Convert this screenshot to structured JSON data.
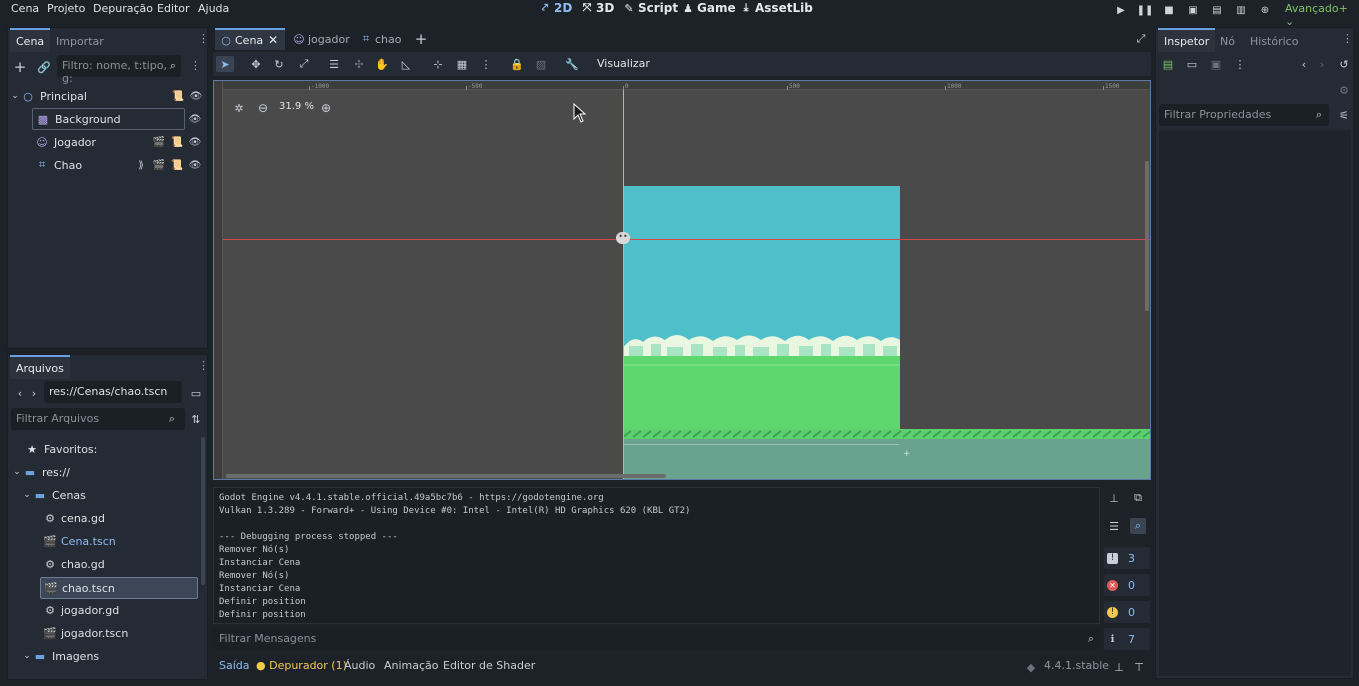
{
  "menu": [
    "Cena",
    "Projeto",
    "Depuração",
    "Editor",
    "Ajuda"
  ],
  "workspaces": [
    {
      "label": "2D",
      "icon": "2d-icon",
      "active": true
    },
    {
      "label": "3D",
      "icon": "3d-icon",
      "active": false
    },
    {
      "label": "Script",
      "icon": "script-icon",
      "active": false
    },
    {
      "label": "Game",
      "icon": "game-icon",
      "active": false
    },
    {
      "label": "AssetLib",
      "icon": "assetlib-icon",
      "active": false
    }
  ],
  "renderer": "Avançado+",
  "scene_dock": {
    "tabs": [
      "Cena",
      "Importar"
    ],
    "filter_placeholder": "Filtro: nome, t:tipo, g:",
    "nodes": [
      {
        "label": "Principal",
        "icon": "node2d-icon",
        "depth": 0
      },
      {
        "label": "Background",
        "icon": "sprite-icon",
        "depth": 1
      },
      {
        "label": "Jogador",
        "icon": "character-icon",
        "depth": 1
      },
      {
        "label": "Chao",
        "icon": "staticbody-icon",
        "depth": 1
      }
    ]
  },
  "filesystem_dock": {
    "tab": "Arquivos",
    "path": "res://Cenas/chao.tscn",
    "filter_placeholder": "Filtrar Arquivos",
    "favorites_label": "Favoritos:",
    "items": [
      {
        "label": "res://",
        "type": "folder"
      },
      {
        "label": "Cenas",
        "type": "folder"
      },
      {
        "label": "cena.gd",
        "type": "script"
      },
      {
        "label": "Cena.tscn",
        "type": "scene",
        "highlight": true
      },
      {
        "label": "chao.gd",
        "type": "script"
      },
      {
        "label": "chao.tscn",
        "type": "scene",
        "selected": true
      },
      {
        "label": "jogador.gd",
        "type": "script"
      },
      {
        "label": "jogador.tscn",
        "type": "scene"
      },
      {
        "label": "Imagens",
        "type": "folder"
      }
    ]
  },
  "editor_tabs": [
    {
      "label": "Cena",
      "active": true,
      "closable": true
    },
    {
      "label": "jogador",
      "active": false
    },
    {
      "label": "chao",
      "active": false
    }
  ],
  "toolbar": {
    "visualizar_label": "Visualizar"
  },
  "viewport": {
    "zoom": "31.9 %",
    "ruler_labels": [
      "-1000",
      "-500",
      "0",
      "500",
      "1000",
      "1500"
    ]
  },
  "output": {
    "lines": [
      "Godot Engine v4.4.1.stable.official.49a5bc7b6 - https://godotengine.org",
      "Vulkan 1.3.289 - Forward+ - Using Device #0: Intel - Intel(R) HD Graphics 620 (KBL GT2)",
      "",
      "--- Debugging process stopped ---",
      "Remover Nó(s)",
      "Instanciar Cena",
      "Remover Nó(s)",
      "Instanciar Cena",
      "Definir position",
      "Definir position"
    ],
    "filter_placeholder": "Filtrar Mensagens",
    "counts": {
      "messages": "3",
      "errors": "0",
      "warnings": "0",
      "info": "7"
    }
  },
  "bottom_tabs": [
    {
      "label": "Saída",
      "active": true
    },
    {
      "label": "Depurador (1)",
      "active": false,
      "dot": true
    },
    {
      "label": "Áudio",
      "active": false
    },
    {
      "label": "Animação",
      "active": false
    },
    {
      "label": "Editor de Shader",
      "active": false
    }
  ],
  "version": "4.4.1.stable",
  "inspector": {
    "tabs": [
      "Inspetor",
      "Nó",
      "Histórico"
    ],
    "filter_placeholder": "Filtrar Propriedades"
  },
  "colors": {
    "accent": "#6ba0e0",
    "sky": "#4fc0ca",
    "grass": "#5ed86e",
    "renderer": "#7fc16a"
  }
}
